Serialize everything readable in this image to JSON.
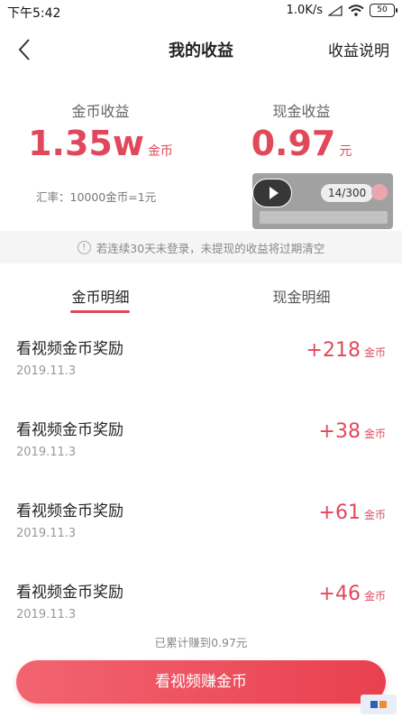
{
  "status_bar": {
    "time": "下午5:42",
    "network_speed": "1.0K/s",
    "battery": "50"
  },
  "nav": {
    "title": "我的收益",
    "help": "收益说明"
  },
  "coin_earnings": {
    "label": "金币收益",
    "value": "1.35w",
    "unit": "金币"
  },
  "cash_earnings": {
    "label": "现金收益",
    "value": "0.97",
    "unit": "元"
  },
  "exchange_rate": "汇率：10000金币=1元",
  "overlay": {
    "counter": "14/300"
  },
  "notice": "若连续30天未登录，未提现的收益将过期清空",
  "tabs": [
    {
      "label": "金币明细"
    },
    {
      "label": "现金明细"
    }
  ],
  "records": [
    {
      "title": "看视频金币奖励",
      "date": "2019.11.3",
      "amount": "+218",
      "unit": "金币"
    },
    {
      "title": "看视频金币奖励",
      "date": "2019.11.3",
      "amount": "+38",
      "unit": "金币"
    },
    {
      "title": "看视频金币奖励",
      "date": "2019.11.3",
      "amount": "+61",
      "unit": "金币"
    },
    {
      "title": "看视频金币奖励",
      "date": "2019.11.3",
      "amount": "+46",
      "unit": "金币"
    }
  ],
  "total_text": "已累计赚到0.97元",
  "cta_label": "看视频赚金币",
  "colors": {
    "accent": "#e0495b",
    "button": "#ec4a59"
  }
}
